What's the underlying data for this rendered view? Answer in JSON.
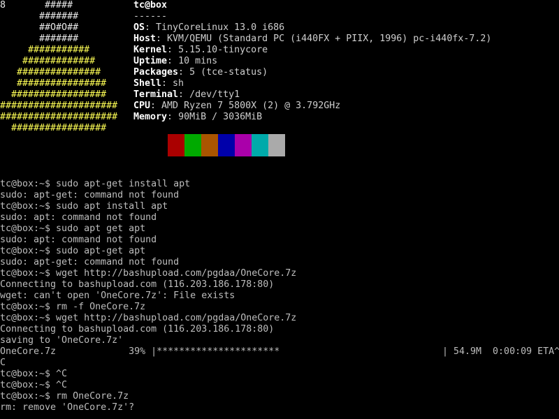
{
  "logo": {
    "lines": [
      "8       #####",
      "       #######",
      "       ##O#O##",
      "       #######",
      "     ###########",
      "    #############",
      "   ###############",
      "   ################",
      "  #################",
      "#####################",
      "#####################",
      "  #################"
    ]
  },
  "sysinfo": {
    "title": "tc@box",
    "separator": "------",
    "rows": [
      {
        "key": "OS",
        "value": "TinyCoreLinux 13.0 i686"
      },
      {
        "key": "Host",
        "value": "KVM/QEMU (Standard PC (i440FX + PIIX, 1996) pc-i440fx-7.2)"
      },
      {
        "key": "Kernel",
        "value": "5.15.10-tinycore"
      },
      {
        "key": "Uptime",
        "value": "10 mins"
      },
      {
        "key": "Packages",
        "value": "5 (tce-status)"
      },
      {
        "key": "Shell",
        "value": "sh"
      },
      {
        "key": "Terminal",
        "value": "/dev/tty1"
      },
      {
        "key": "CPU",
        "value": "AMD Ryzen 7 5800X (2) @ 3.792GHz"
      },
      {
        "key": "Memory",
        "value": "90MiB / 3036MiB"
      }
    ]
  },
  "palette": {
    "colors": [
      "#000000",
      "#aa0000",
      "#00aa00",
      "#aa5500",
      "#0000aa",
      "#aa00aa",
      "#00aaaa",
      "#aaaaaa"
    ]
  },
  "terminal": {
    "lines": [
      "tc@box:~$ sudo apt-get install apt",
      "sudo: apt-get: command not found",
      "tc@box:~$ sudo apt install apt",
      "sudo: apt: command not found",
      "tc@box:~$ sudo apt get apt",
      "sudo: apt: command not found",
      "tc@box:~$ sudo apt-get apt",
      "sudo: apt-get: command not found",
      "tc@box:~$ wget http://bashupload.com/pgdaa/OneCore.7z",
      "Connecting to bashupload.com (116.203.186.178:80)",
      "wget: can't open 'OneCore.7z': File exists",
      "tc@box:~$ rm -f OneCore.7z",
      "tc@box:~$ wget http://bashupload.com/pgdaa/OneCore.7z",
      "Connecting to bashupload.com (116.203.186.178:80)",
      "saving to 'OneCore.7z'",
      "",
      "C",
      "tc@box:~$ ^C",
      "tc@box:~$ ^C",
      "tc@box:~$ rm OneCore.7z",
      "rm: remove 'OneCore.7z'?"
    ],
    "progress": {
      "left": "OneCore.7z             39% |**********************",
      "right": "| 54.9M  0:00:09 ETA^",
      "percent": 39
    }
  }
}
